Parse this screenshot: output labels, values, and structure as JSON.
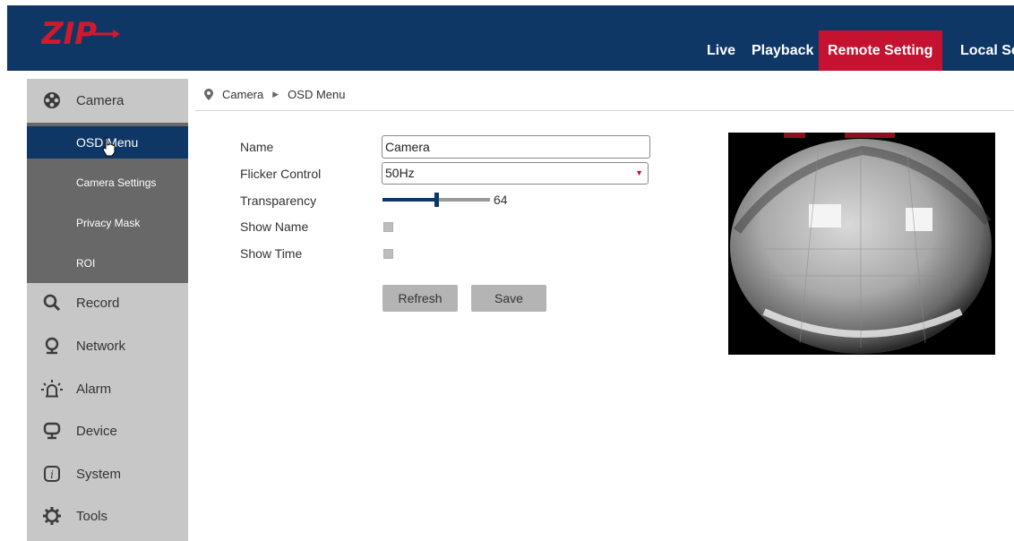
{
  "header": {
    "logo_text": "ZIP",
    "nav": [
      {
        "label": "Live",
        "active": false
      },
      {
        "label": "Playback",
        "active": false
      },
      {
        "label": "Remote Setting",
        "active": true
      },
      {
        "label": "Local Sett",
        "active": false
      }
    ],
    "colors": {
      "bar": "#0e3766",
      "active": "#c41230"
    }
  },
  "sidebar": {
    "items": [
      {
        "label": "Camera",
        "icon": "camera-icon",
        "expanded": true
      },
      {
        "label": "Record",
        "icon": "search-icon"
      },
      {
        "label": "Network",
        "icon": "network-icon"
      },
      {
        "label": "Alarm",
        "icon": "alarm-icon"
      },
      {
        "label": "Device",
        "icon": "device-icon"
      },
      {
        "label": "System",
        "icon": "system-icon"
      },
      {
        "label": "Tools",
        "icon": "tools-icon"
      }
    ],
    "camera_submenu": [
      {
        "label": "OSD Menu",
        "active": true
      },
      {
        "label": "Camera Settings",
        "active": false
      },
      {
        "label": "Privacy Mask",
        "active": false
      },
      {
        "label": "ROI",
        "active": false
      }
    ]
  },
  "breadcrumb": {
    "root": "Camera",
    "current": "OSD Menu"
  },
  "form": {
    "name_label": "Name",
    "name_value": "Camera",
    "flicker_label": "Flicker Control",
    "flicker_value": "50Hz",
    "transparency_label": "Transparency",
    "transparency_value": 64,
    "transparency_display": "64",
    "transparency_max": 128,
    "show_name_label": "Show Name",
    "show_name_checked": false,
    "show_time_label": "Show Time",
    "show_time_checked": false,
    "refresh_label": "Refresh",
    "save_label": "Save"
  },
  "preview": {
    "view": "fisheye camera live image"
  }
}
